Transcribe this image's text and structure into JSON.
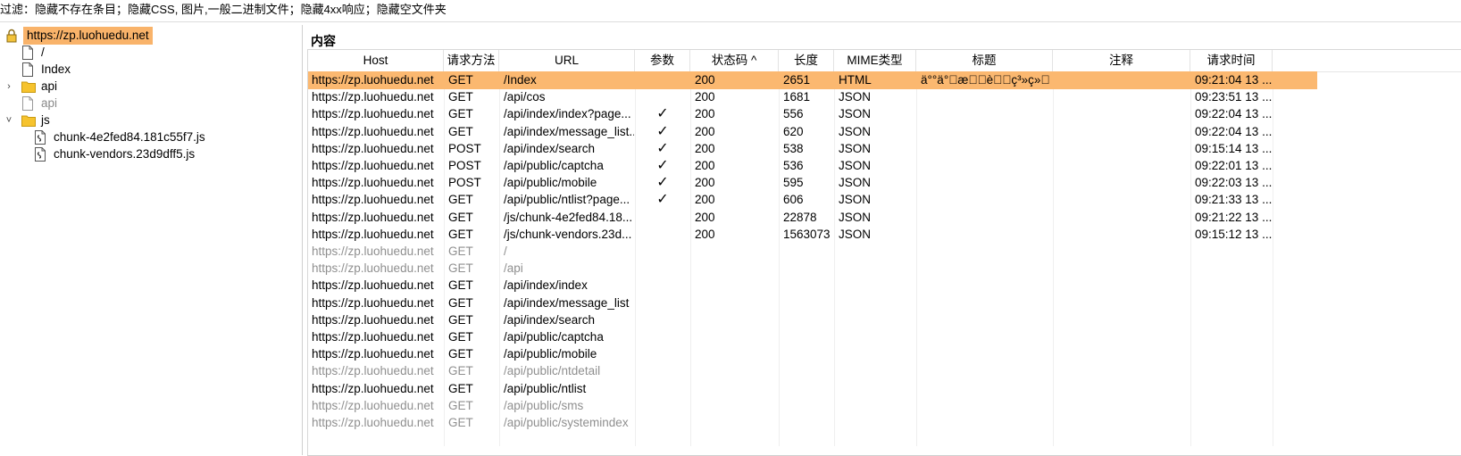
{
  "filter": {
    "text": "过滤：隐藏不存在条目；隐藏CSS, 图片,一般二进制文件；隐藏4xx响应；隐藏空文件夹"
  },
  "tree": {
    "root": "https://zp.luohuedu.net",
    "items": [
      {
        "label": "/",
        "grey": false
      },
      {
        "label": "Index",
        "grey": false
      },
      {
        "label": "api",
        "grey": false
      },
      {
        "label": "api",
        "grey": true
      },
      {
        "label": "js",
        "grey": false
      },
      {
        "label": "chunk-4e2fed84.181c55f7.js",
        "grey": false
      },
      {
        "label": "chunk-vendors.23d9dff5.js",
        "grey": false
      }
    ],
    "chevron_right": "›",
    "chevron_down": "˅"
  },
  "content": {
    "title": "内容",
    "columns": [
      "Host",
      "请求方法",
      "URL",
      "参数",
      "状态码 ^",
      "长度",
      "MIME类型",
      "标题",
      "注释",
      "请求时间"
    ],
    "rows": [
      {
        "host": "https://zp.luohuedu.net",
        "method": "GET",
        "url": "/Index",
        "param": "",
        "status": "200",
        "length": "2651",
        "mime": "HTML",
        "title": "ä°°ä°\u0000æ\u0000\u0000è\u0000\u0000ç³»ç»\u0000",
        "note": "",
        "time": "09:21:04 13 ...",
        "grey": false,
        "sel": true
      },
      {
        "host": "https://zp.luohuedu.net",
        "method": "GET",
        "url": "/api/cos",
        "param": "",
        "status": "200",
        "length": "1681",
        "mime": "JSON",
        "title": "",
        "note": "",
        "time": "09:23:51 13 ...",
        "grey": false,
        "sel": false
      },
      {
        "host": "https://zp.luohuedu.net",
        "method": "GET",
        "url": "/api/index/index?page...",
        "param": "✓",
        "status": "200",
        "length": "556",
        "mime": "JSON",
        "title": "",
        "note": "",
        "time": "09:22:04 13 ...",
        "grey": false,
        "sel": false
      },
      {
        "host": "https://zp.luohuedu.net",
        "method": "GET",
        "url": "/api/index/message_list...",
        "param": "✓",
        "status": "200",
        "length": "620",
        "mime": "JSON",
        "title": "",
        "note": "",
        "time": "09:22:04 13 ...",
        "grey": false,
        "sel": false
      },
      {
        "host": "https://zp.luohuedu.net",
        "method": "POST",
        "url": "/api/index/search",
        "param": "✓",
        "status": "200",
        "length": "538",
        "mime": "JSON",
        "title": "",
        "note": "",
        "time": "09:15:14 13 ...",
        "grey": false,
        "sel": false
      },
      {
        "host": "https://zp.luohuedu.net",
        "method": "POST",
        "url": "/api/public/captcha",
        "param": "✓",
        "status": "200",
        "length": "536",
        "mime": "JSON",
        "title": "",
        "note": "",
        "time": "09:22:01 13 ...",
        "grey": false,
        "sel": false
      },
      {
        "host": "https://zp.luohuedu.net",
        "method": "POST",
        "url": "/api/public/mobile",
        "param": "✓",
        "status": "200",
        "length": "595",
        "mime": "JSON",
        "title": "",
        "note": "",
        "time": "09:22:03 13 ...",
        "grey": false,
        "sel": false
      },
      {
        "host": "https://zp.luohuedu.net",
        "method": "GET",
        "url": "/api/public/ntlist?page...",
        "param": "✓",
        "status": "200",
        "length": "606",
        "mime": "JSON",
        "title": "",
        "note": "",
        "time": "09:21:33 13 ...",
        "grey": false,
        "sel": false
      },
      {
        "host": "https://zp.luohuedu.net",
        "method": "GET",
        "url": "/js/chunk-4e2fed84.18...",
        "param": "",
        "status": "200",
        "length": "22878",
        "mime": "JSON",
        "title": "",
        "note": "",
        "time": "09:21:22 13 ...",
        "grey": false,
        "sel": false
      },
      {
        "host": "https://zp.luohuedu.net",
        "method": "GET",
        "url": "/js/chunk-vendors.23d...",
        "param": "",
        "status": "200",
        "length": "1563073",
        "mime": "JSON",
        "title": "",
        "note": "",
        "time": "09:15:12 13 ...",
        "grey": false,
        "sel": false
      },
      {
        "host": "https://zp.luohuedu.net",
        "method": "GET",
        "url": "/",
        "param": "",
        "status": "",
        "length": "",
        "mime": "",
        "title": "",
        "note": "",
        "time": "",
        "grey": true,
        "sel": false
      },
      {
        "host": "https://zp.luohuedu.net",
        "method": "GET",
        "url": "/api",
        "param": "",
        "status": "",
        "length": "",
        "mime": "",
        "title": "",
        "note": "",
        "time": "",
        "grey": true,
        "sel": false
      },
      {
        "host": "https://zp.luohuedu.net",
        "method": "GET",
        "url": "/api/index/index",
        "param": "",
        "status": "",
        "length": "",
        "mime": "",
        "title": "",
        "note": "",
        "time": "",
        "grey": false,
        "sel": false
      },
      {
        "host": "https://zp.luohuedu.net",
        "method": "GET",
        "url": "/api/index/message_list",
        "param": "",
        "status": "",
        "length": "",
        "mime": "",
        "title": "",
        "note": "",
        "time": "",
        "grey": false,
        "sel": false
      },
      {
        "host": "https://zp.luohuedu.net",
        "method": "GET",
        "url": "/api/index/search",
        "param": "",
        "status": "",
        "length": "",
        "mime": "",
        "title": "",
        "note": "",
        "time": "",
        "grey": false,
        "sel": false
      },
      {
        "host": "https://zp.luohuedu.net",
        "method": "GET",
        "url": "/api/public/captcha",
        "param": "",
        "status": "",
        "length": "",
        "mime": "",
        "title": "",
        "note": "",
        "time": "",
        "grey": false,
        "sel": false
      },
      {
        "host": "https://zp.luohuedu.net",
        "method": "GET",
        "url": "/api/public/mobile",
        "param": "",
        "status": "",
        "length": "",
        "mime": "",
        "title": "",
        "note": "",
        "time": "",
        "grey": false,
        "sel": false
      },
      {
        "host": "https://zp.luohuedu.net",
        "method": "GET",
        "url": "/api/public/ntdetail",
        "param": "",
        "status": "",
        "length": "",
        "mime": "",
        "title": "",
        "note": "",
        "time": "",
        "grey": true,
        "sel": false
      },
      {
        "host": "https://zp.luohuedu.net",
        "method": "GET",
        "url": "/api/public/ntlist",
        "param": "",
        "status": "",
        "length": "",
        "mime": "",
        "title": "",
        "note": "",
        "time": "",
        "grey": false,
        "sel": false
      },
      {
        "host": "https://zp.luohuedu.net",
        "method": "GET",
        "url": "/api/public/sms",
        "param": "",
        "status": "",
        "length": "",
        "mime": "",
        "title": "",
        "note": "",
        "time": "",
        "grey": true,
        "sel": false
      },
      {
        "host": "https://zp.luohuedu.net",
        "method": "GET",
        "url": "/api/public/systemindex",
        "param": "",
        "status": "",
        "length": "",
        "mime": "",
        "title": "",
        "note": "",
        "time": "",
        "grey": true,
        "sel": false
      }
    ]
  },
  "colors": {
    "selection": "#fbb870",
    "grey_text": "#8f8f8f"
  },
  "icons": {
    "lock": "lock-icon",
    "file": "file-icon",
    "folder": "folder-icon",
    "script": "script-file-icon"
  }
}
